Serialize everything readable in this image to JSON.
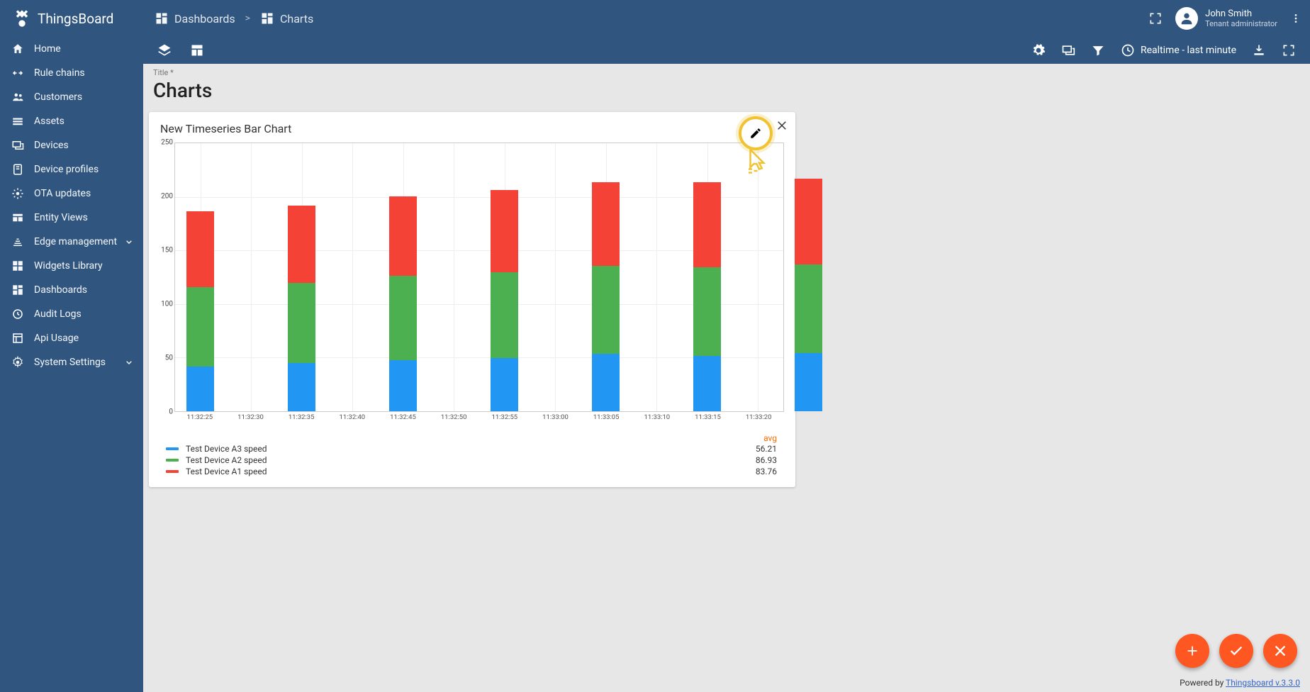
{
  "brand": "ThingsBoard",
  "breadcrumbs": {
    "root": "Dashboards",
    "current": "Charts"
  },
  "user": {
    "name": "John Smith",
    "role": "Tenant administrator"
  },
  "sidebar": {
    "items": [
      {
        "icon": "home",
        "label": "Home"
      },
      {
        "icon": "chain",
        "label": "Rule chains"
      },
      {
        "icon": "customers",
        "label": "Customers"
      },
      {
        "icon": "assets",
        "label": "Assets"
      },
      {
        "icon": "devices",
        "label": "Devices"
      },
      {
        "icon": "devprofiles",
        "label": "Device profiles"
      },
      {
        "icon": "ota",
        "label": "OTA updates"
      },
      {
        "icon": "entityviews",
        "label": "Entity Views"
      },
      {
        "icon": "edge",
        "label": "Edge management",
        "expandable": true
      },
      {
        "icon": "widgets",
        "label": "Widgets Library"
      },
      {
        "icon": "dashboards",
        "label": "Dashboards"
      },
      {
        "icon": "audit",
        "label": "Audit Logs"
      },
      {
        "icon": "api",
        "label": "Api Usage"
      },
      {
        "icon": "settings",
        "label": "System Settings",
        "expandable": true
      }
    ]
  },
  "toolbar": {
    "time_label": "Realtime - last minute"
  },
  "page": {
    "title_label": "Title *",
    "title": "Charts"
  },
  "widget": {
    "title": "New Timeseries Bar Chart"
  },
  "legend": {
    "header": "avg",
    "rows": [
      {
        "color": "#2196f3",
        "label": "Test Device A3 speed",
        "value": "56.21"
      },
      {
        "color": "#4caf50",
        "label": "Test Device A2 speed",
        "value": "86.93"
      },
      {
        "color": "#f44336",
        "label": "Test Device A1 speed",
        "value": "83.76"
      }
    ]
  },
  "chart_data": {
    "type": "bar",
    "stacked": true,
    "ylim": [
      0,
      250
    ],
    "yticks": [
      0,
      50,
      100,
      150,
      200,
      250
    ],
    "x_ticks": [
      "11:32:25",
      "11:32:30",
      "11:32:35",
      "11:32:40",
      "11:32:45",
      "11:32:50",
      "11:32:55",
      "11:33:00",
      "11:33:05",
      "11:33:10",
      "11:33:15",
      "11:33:20"
    ],
    "bar_x_indices": [
      0,
      2,
      4,
      6,
      8,
      10,
      12
    ],
    "colors": {
      "A3": "#2196f3",
      "A2": "#4caf50",
      "A1": "#f44336"
    },
    "series": [
      {
        "name": "Test Device A3 speed",
        "key": "A3",
        "values": [
          48,
          51,
          53,
          55,
          58,
          56,
          58
        ]
      },
      {
        "name": "Test Device A2 speed",
        "key": "A2",
        "values": [
          86,
          86,
          88,
          88,
          89,
          89,
          89
        ]
      },
      {
        "name": "Test Device A1 speed",
        "key": "A1",
        "values": [
          82,
          82,
          83,
          84,
          84,
          86,
          86
        ]
      }
    ],
    "xlabel": "",
    "ylabel": ""
  },
  "footer": {
    "text": "Powered by ",
    "link_text": "Thingsboard v.3.3.0"
  }
}
